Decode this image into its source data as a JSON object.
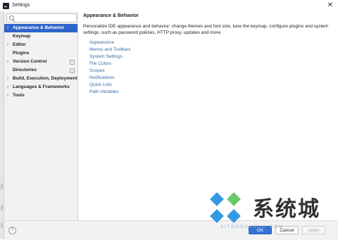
{
  "window": {
    "title": "Settings",
    "close_glyph": "✕"
  },
  "search": {
    "placeholder": "",
    "value": ""
  },
  "sidebar": {
    "items": [
      {
        "label": "Appearance & Behavior",
        "expandable": true,
        "selected": true,
        "arrow": "›"
      },
      {
        "label": "Keymap",
        "expandable": false
      },
      {
        "label": "Editor",
        "expandable": true,
        "arrow": "›"
      },
      {
        "label": "Plugins",
        "expandable": false
      },
      {
        "label": "Version Control",
        "expandable": true,
        "arrow": "›",
        "project_icon": true
      },
      {
        "label": "Directories",
        "expandable": false,
        "project_icon": true
      },
      {
        "label": "Build, Execution, Deployment",
        "expandable": true,
        "arrow": "›"
      },
      {
        "label": "Languages & Frameworks",
        "expandable": true,
        "arrow": "›"
      },
      {
        "label": "Tools",
        "expandable": true,
        "arrow": "›"
      }
    ]
  },
  "content": {
    "title": "Appearance & Behavior",
    "description": "Personalize IDE appearance and behavior: change themes and font size, tune the keymap, configure plugins and system settings, such as password policies, HTTP proxy, updates and more.",
    "links": [
      "Appearance",
      "Menus and Toolbars",
      "System Settings",
      "File Colors",
      "Scopes",
      "Notifications",
      "Quick Lists",
      "Path Variables"
    ]
  },
  "footer": {
    "help_label": "?",
    "ok_label": "OK",
    "cancel_label": "Cancel",
    "apply_label": "Apply"
  },
  "watermark": {
    "text_zh": "系统城",
    "text_en": "XITONGCHENG.COM"
  },
  "colors": {
    "selection": "#2f65ca",
    "link": "#3a6ea5",
    "primary_button": "#3574d4",
    "watermark_blue": "#1d8fe1"
  },
  "icons": {
    "app": "app-icon",
    "search": "search-icon",
    "close": "close-icon",
    "help": "help-icon"
  }
}
